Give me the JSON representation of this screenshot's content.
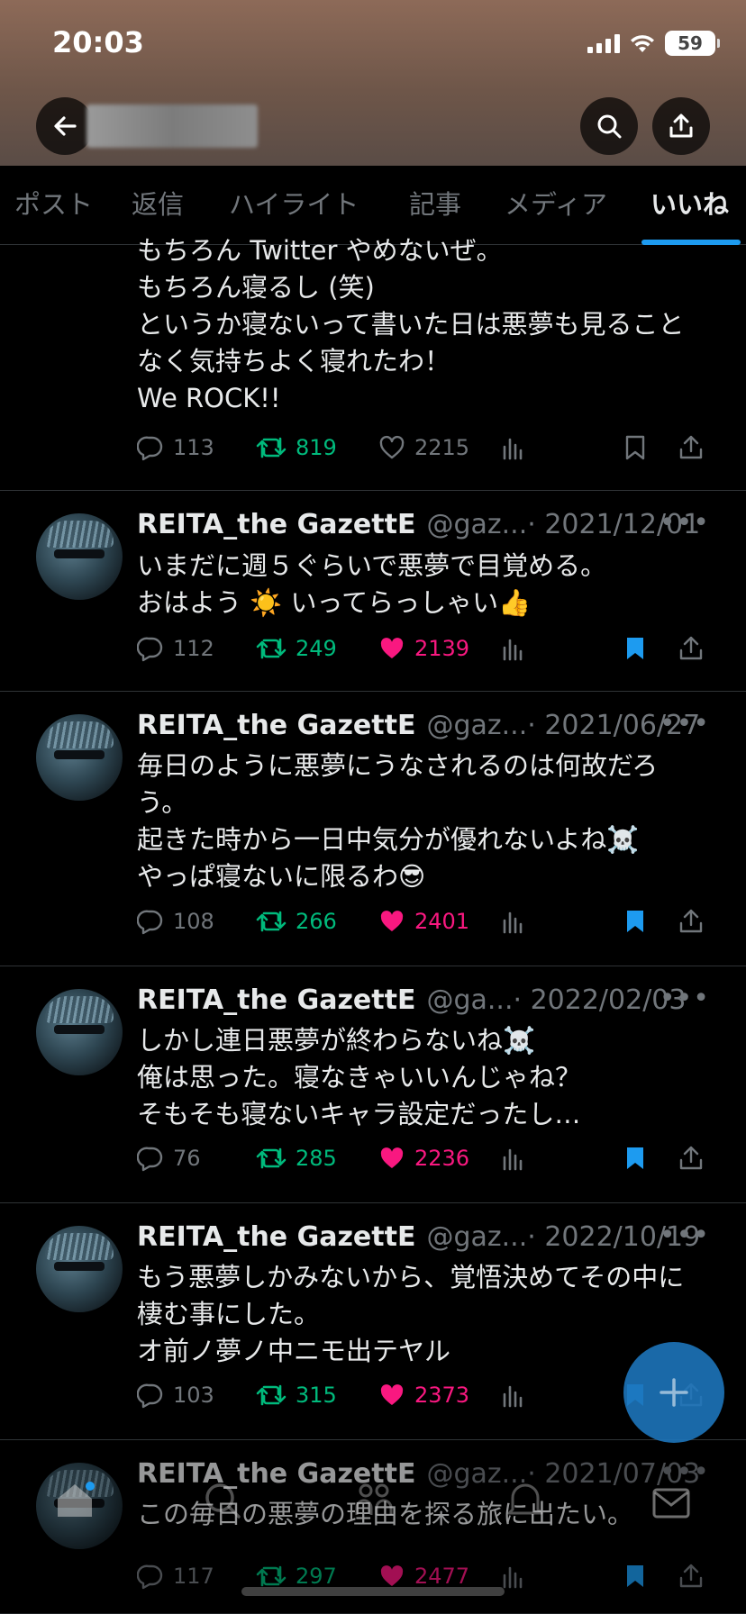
{
  "status_bar": {
    "time": "20:03",
    "battery": "59"
  },
  "tabs": [
    {
      "label": "ポスト"
    },
    {
      "label": "返信"
    },
    {
      "label": "ハイライト"
    },
    {
      "label": "記事"
    },
    {
      "label": "メディア"
    },
    {
      "label": "いいね",
      "active": true
    }
  ],
  "partial_tweet": {
    "lines": [
      "もちろん Twitter やめないぜ。",
      "もちろん寝るし (笑)",
      "というか寝ないって書いた日は悪夢も見ること",
      "なく気持ちよく寝れたわ！",
      "We ROCK!!"
    ],
    "replies": "113",
    "retweets": "819",
    "likes": "2215",
    "liked": false,
    "bookmarked": false
  },
  "tweets": [
    {
      "name": "REITA_the GazettE",
      "handle": "@gaz...",
      "date": "· 2021/12/01",
      "lines": [
        "いまだに週５ぐらいで悪夢で目覚める。",
        "おはよう ☀️ いってらっしゃい👍"
      ],
      "replies": "112",
      "retweets": "249",
      "likes": "2139",
      "liked": true,
      "bookmarked": true
    },
    {
      "name": "REITA_the GazettE",
      "handle": "@gaz...",
      "date": "· 2021/06/27",
      "lines": [
        "毎日のように悪夢にうなされるのは何故だろ",
        "う。",
        "起きた時から一日中気分が優れないよね☠️",
        "やっぱ寝ないに限るわ😎"
      ],
      "replies": "108",
      "retweets": "266",
      "likes": "2401",
      "liked": true,
      "bookmarked": true
    },
    {
      "name": "REITA_the GazettE",
      "handle": "@ga...",
      "date": "· 2022/02/03",
      "lines": [
        "しかし連日悪夢が終わらないね☠️",
        "俺は思った。寝なきゃいいんじゃね？",
        "そもそも寝ないキャラ設定だったし…"
      ],
      "replies": "76",
      "retweets": "285",
      "likes": "2236",
      "liked": true,
      "bookmarked": true
    },
    {
      "name": "REITA_the GazettE",
      "handle": "@gaz...",
      "date": "· 2022/10/19",
      "lines": [
        "もう悪夢しかみないから、覚悟決めてその中に",
        "棲む事にした。",
        "オ前ノ夢ノ中ニモ出テヤル"
      ],
      "replies": "103",
      "retweets": "315",
      "likes": "2373",
      "liked": true,
      "bookmarked": true
    },
    {
      "name": "REITA_the GazettE",
      "handle": "@gaz...",
      "date": "· 2021/07/03",
      "lines": [
        "この毎日の悪夢の理由を探る旅に出たい。"
      ],
      "replies": "117",
      "retweets": "297",
      "likes": "2477",
      "liked": true,
      "bookmarked": true
    }
  ],
  "colors": {
    "accent": "#1d9bf0",
    "retweet": "#00ba7c",
    "like": "#f91880",
    "bookmark": "#1d9bf0",
    "muted": "#71767b"
  },
  "icons": [
    "back-arrow-icon",
    "search-icon",
    "share-icon",
    "reply-icon",
    "retweet-icon",
    "heart-icon",
    "views-icon",
    "bookmark-icon",
    "more-icon",
    "plus-icon",
    "home-icon",
    "explore-icon",
    "communities-icon",
    "notifications-icon",
    "messages-icon"
  ]
}
